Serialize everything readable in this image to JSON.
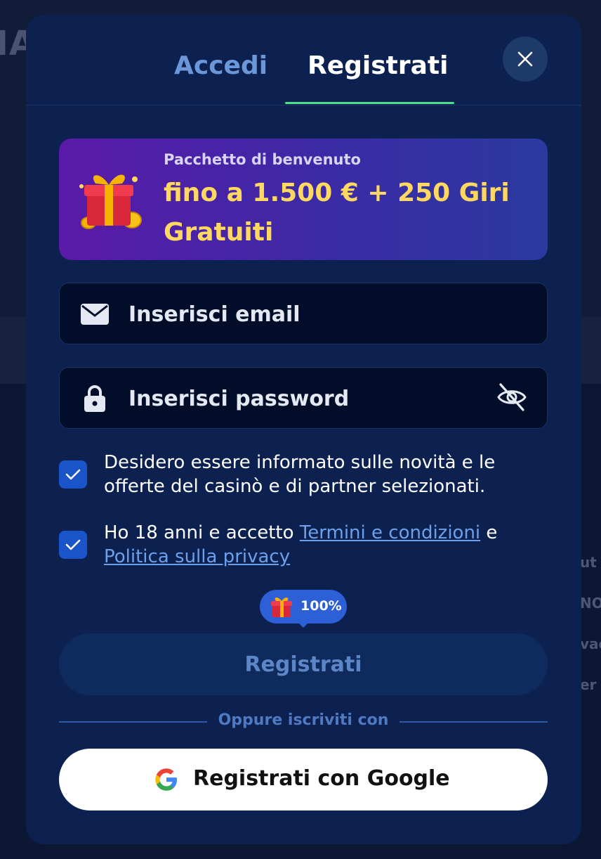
{
  "background": {
    "logo_fragment": "IA",
    "side_texts": [
      "ut",
      "NO",
      "vac",
      "er"
    ]
  },
  "tabs": [
    {
      "label": "Accedi",
      "active": false
    },
    {
      "label": "Registrati",
      "active": true
    }
  ],
  "promo": {
    "subtitle": "Pacchetto di benvenuto",
    "title": "fino a 1.500 € + 250 Giri Gratuiti",
    "icon": "gift-icon"
  },
  "form": {
    "email": {
      "value": "",
      "placeholder": "Inserisci email",
      "icon": "envelope-icon"
    },
    "password": {
      "value": "",
      "placeholder": "Inserisci password",
      "icon": "lock-icon",
      "toggle_icon": "eye-off-icon"
    },
    "consent_marketing": {
      "checked": true,
      "text": "Desidero essere informato sulle novità e le offerte del casinò e di partner selezionati."
    },
    "consent_terms": {
      "checked": true,
      "text_before": "Ho 18 anni e accetto ",
      "link_terms": "Termini e condizioni",
      "text_between": " e ",
      "link_privacy": "Politica sulla privacy"
    },
    "bonus_badge": "100%",
    "submit_label": "Registrati"
  },
  "divider_text": "Oppure iscriviti con",
  "google_button_label": "Registrati con Google",
  "colors": {
    "accent_green": "#4ce08a",
    "promo_gold": "#ffd860",
    "checkbox_blue": "#1954c8",
    "link_blue": "#6ca0ea"
  }
}
